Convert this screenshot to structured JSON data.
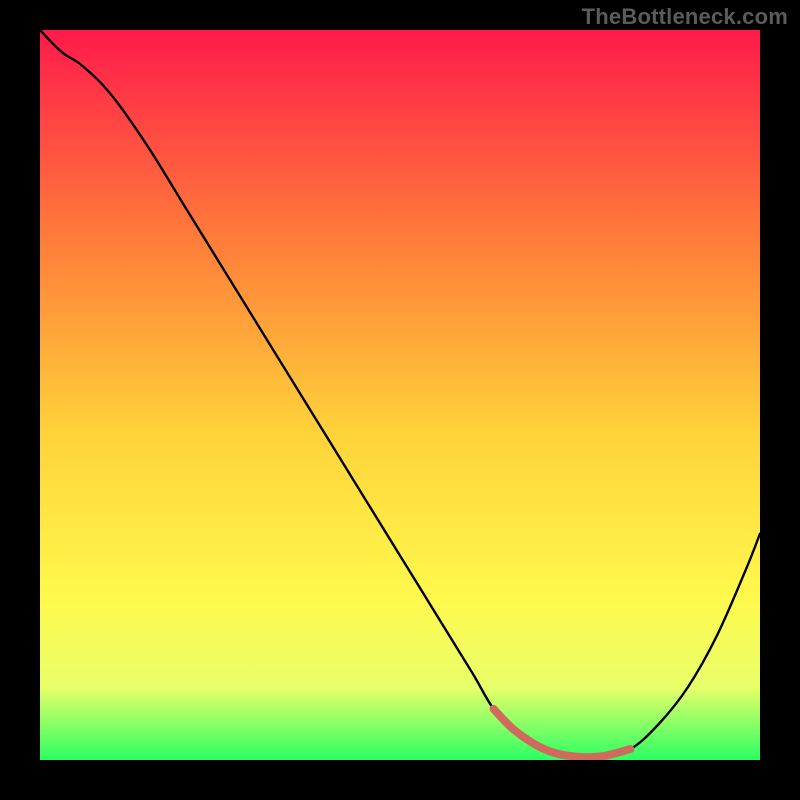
{
  "watermark": "TheBottleneck.com",
  "colors": {
    "frame_bg": "#000000",
    "curve": "#000000",
    "highlight": "#cf6a5e",
    "grad_top": "#ff1a4b",
    "grad_mid_upper": "#ff7a3a",
    "grad_mid": "#ffd23a",
    "grad_mid_lower": "#fff94d",
    "grad_low": "#e9ff6a",
    "grad_bottom": "#2bff62"
  },
  "chart_data": {
    "type": "line",
    "title": "",
    "xlabel": "",
    "ylabel": "",
    "xlim": [
      0,
      100
    ],
    "ylim": [
      0,
      100
    ],
    "x": [
      0,
      3,
      6,
      10,
      15,
      20,
      25,
      30,
      35,
      40,
      45,
      50,
      55,
      60,
      63,
      66,
      70,
      74,
      78,
      82,
      86,
      90,
      94,
      98,
      100
    ],
    "values": [
      100,
      97,
      95,
      91,
      84,
      76,
      68,
      60,
      52,
      44,
      36,
      28,
      20,
      12,
      7,
      4,
      1.5,
      0.5,
      0.5,
      1.5,
      5,
      10,
      17,
      26,
      31
    ],
    "highlight_segment": {
      "x": [
        63,
        66,
        70,
        74,
        78,
        82
      ],
      "values": [
        7,
        4,
        1.5,
        0.5,
        0.5,
        1.5
      ]
    },
    "annotations": []
  }
}
